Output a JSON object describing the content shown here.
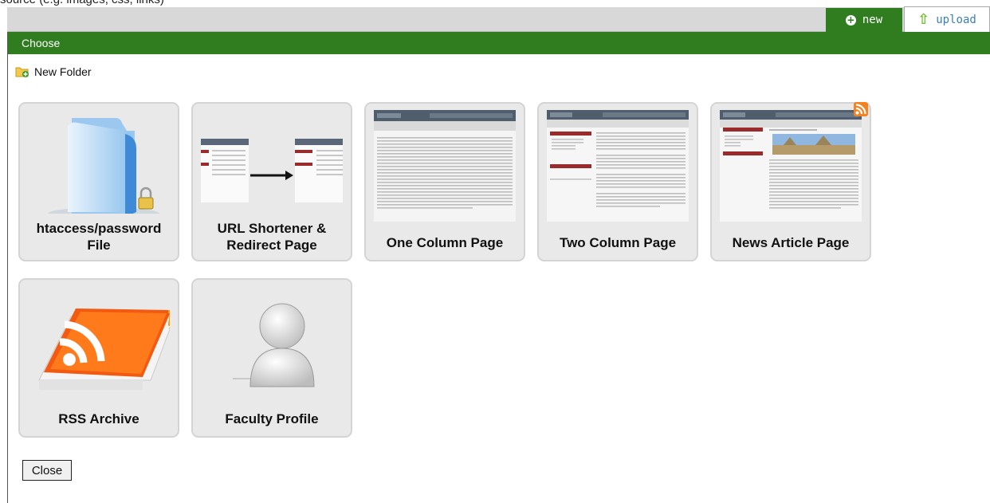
{
  "caption": "source (e.g. images, css, links)",
  "tabs": {
    "new_label": "new",
    "upload_label": "upload"
  },
  "panel": {
    "title": "Choose"
  },
  "new_folder_label": "New Folder",
  "templates": [
    {
      "line1": "htaccess/password",
      "line2": "File",
      "icon": "folder-lock-icon"
    },
    {
      "line1": "URL Shortener &",
      "line2": "Redirect Page",
      "icon": "redirect-icon"
    },
    {
      "line1": "One Column Page",
      "line2": "",
      "icon": "one-column-thumbnail"
    },
    {
      "line1": "Two Column Page",
      "line2": "",
      "icon": "two-column-thumbnail"
    },
    {
      "line1": "News Article Page",
      "line2": "",
      "icon": "news-article-thumbnail"
    },
    {
      "line1": "RSS Archive",
      "line2": "",
      "icon": "rss-book-icon"
    },
    {
      "line1": "Faculty Profile",
      "line2": "",
      "icon": "person-icon"
    }
  ],
  "close_label": "Close",
  "colors": {
    "green_bar": "#2f7d1f",
    "upload_text": "#3b7fb5",
    "card_bg": "#e9e9e9",
    "rss_orange": "#f58220"
  }
}
